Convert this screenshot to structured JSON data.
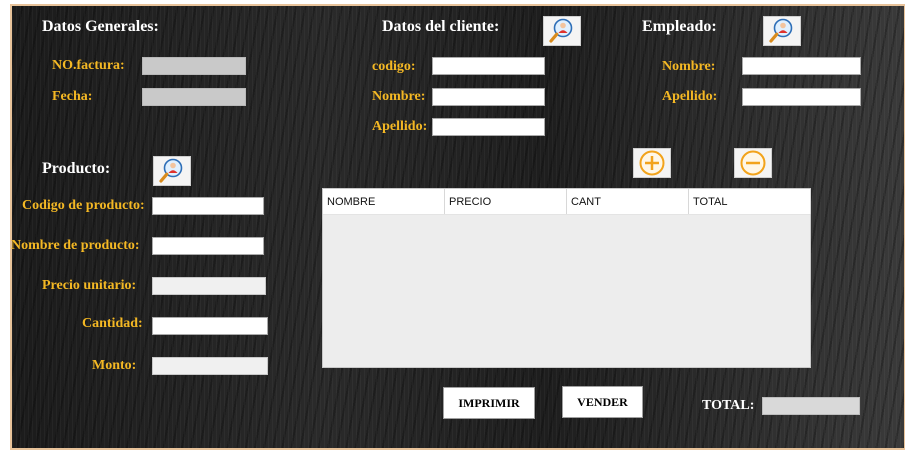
{
  "general": {
    "title": "Datos Generales:",
    "factura_label": "NO.factura:",
    "fecha_label": "Fecha:",
    "factura_value": "",
    "fecha_value": ""
  },
  "cliente": {
    "title": "Datos del cliente:",
    "codigo_label": "codigo:",
    "nombre_label": "Nombre:",
    "apellido_label": "Apellido:",
    "codigo_value": "",
    "nombre_value": "",
    "apellido_value": ""
  },
  "empleado": {
    "title": "Empleado:",
    "nombre_label": "Nombre:",
    "apellido_label": "Apellido:",
    "nombre_value": "",
    "apellido_value": ""
  },
  "producto": {
    "title": "Producto:",
    "codigo_label": "Codigo de producto:",
    "nombre_label": "Nombre de producto:",
    "precio_label": "Precio unitario:",
    "cantidad_label": "Cantidad:",
    "monto_label": "Monto:",
    "codigo_value": "",
    "nombre_value": "",
    "precio_value": "",
    "cantidad_value": "",
    "monto_value": ""
  },
  "table": {
    "columns": [
      "NOMBRE",
      "PRECIO",
      "CANT",
      "TOTAL"
    ],
    "rows": []
  },
  "actions": {
    "imprimir_label": "IMPRIMIR",
    "vender_label": "VENDER",
    "total_label": "TOTAL:",
    "total_value": ""
  },
  "icons": {
    "search": "search-user-icon",
    "add": "add-circle-icon",
    "remove": "remove-circle-icon"
  },
  "colors": {
    "label": "#f4b824",
    "header": "#ffffff",
    "accent_icon": "#f2a31b",
    "frame_border": "#e8c39a"
  }
}
